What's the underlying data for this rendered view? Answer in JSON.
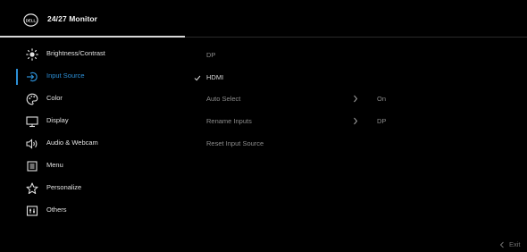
{
  "header": {
    "logo_text": "DELL",
    "title": "24/27 Monitor"
  },
  "menu": {
    "items": [
      {
        "label": "Brightness/Contrast",
        "icon": "brightness-icon",
        "active": false
      },
      {
        "label": "Input Source",
        "icon": "input-source-icon",
        "active": true
      },
      {
        "label": "Color",
        "icon": "color-palette-icon",
        "active": false
      },
      {
        "label": "Display",
        "icon": "display-icon",
        "active": false
      },
      {
        "label": "Audio & Webcam",
        "icon": "speaker-icon",
        "active": false
      },
      {
        "label": "Menu",
        "icon": "menu-icon",
        "active": false
      },
      {
        "label": "Personalize",
        "icon": "star-icon",
        "active": false
      },
      {
        "label": "Others",
        "icon": "others-icon",
        "active": false
      }
    ]
  },
  "submenu": {
    "items": [
      {
        "label": "DP",
        "selected": false,
        "checked": false,
        "arrow": false,
        "value": ""
      },
      {
        "label": "HDMI",
        "selected": true,
        "checked": true,
        "arrow": false,
        "value": ""
      },
      {
        "label": "Auto Select",
        "selected": false,
        "checked": false,
        "arrow": true,
        "value": "On"
      },
      {
        "label": "Rename Inputs",
        "selected": false,
        "checked": false,
        "arrow": true,
        "value": "DP"
      },
      {
        "label": "Reset Input Source",
        "selected": false,
        "checked": false,
        "arrow": false,
        "value": ""
      }
    ]
  },
  "footer": {
    "exit_label": "Exit"
  },
  "colors": {
    "accent": "#2c8fd6",
    "background": "#000000",
    "text": "#e2e2e2",
    "muted_text": "#8c8c8c"
  }
}
